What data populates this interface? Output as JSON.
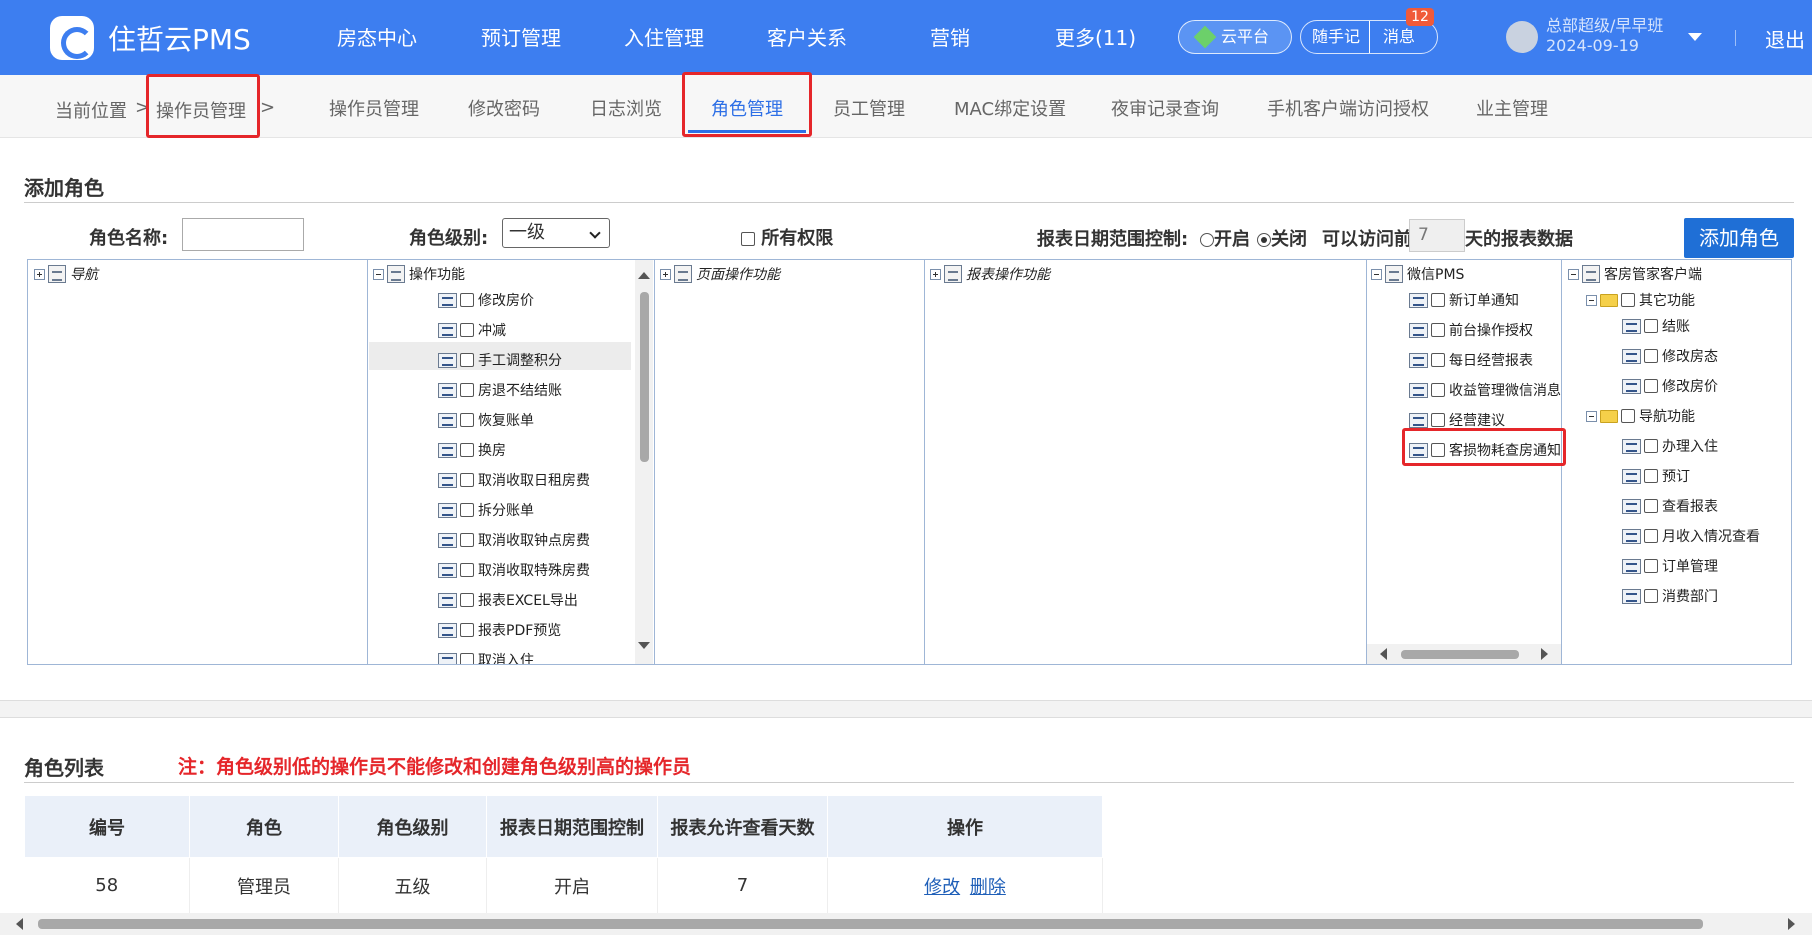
{
  "header": {
    "brand": "住哲云PMS",
    "nav": [
      "房态中心",
      "预订管理",
      "入住管理",
      "客户关系",
      "营销",
      "更多(11)"
    ],
    "cloud_platform": "云平台",
    "notes": "随手记",
    "messages": "消息",
    "message_count": "12",
    "user_name": "总部超级/早早班",
    "user_date": "2024-09-19",
    "logout": "退出"
  },
  "breadcrumb": {
    "label": "当前位置",
    "sep": ">",
    "current": "操作员管理",
    "sep2": ">"
  },
  "tabs": [
    "操作员管理",
    "修改密码",
    "日志浏览",
    "角色管理",
    "员工管理",
    "MAC绑定设置",
    "夜审记录查询",
    "手机客户端访问授权",
    "业主管理"
  ],
  "active_tab": "角色管理",
  "add_role": {
    "title": "添加角色",
    "name_label": "角色名称:",
    "name_value": "",
    "level_label": "角色级别:",
    "level_value": "一级",
    "all_permissions": "所有权限",
    "date_range_label": "报表日期范围控制:",
    "opt_on": "开启",
    "opt_off": "关闭",
    "access_prefix": "可以访问前",
    "days_value": "7",
    "access_suffix": "天的报表数据",
    "add_button": "添加角色"
  },
  "tree": {
    "nav_root": "导航",
    "op_root": "操作功能",
    "op_items": [
      "修改房价",
      "冲减",
      "手工调整积分",
      "房退不结结账",
      "恢复账单",
      "换房",
      "取消收取日租房费",
      "拆分账单",
      "取消收取钟点房费",
      "取消收取特殊房费",
      "报表EXCEL导出",
      "报表PDF预览",
      "取消入住"
    ],
    "page_root": "页面操作功能",
    "report_root": "报表操作功能",
    "wx_root": "微信PMS",
    "wx_items": [
      "新订单通知",
      "前台操作授权",
      "每日经营报表",
      "收益管理微信消息",
      "经营建议",
      "客损物耗查房通知"
    ],
    "hk_root": "客房管家客户端",
    "hk_group1": "其它功能",
    "hk_group1_items": [
      "结账",
      "修改房态",
      "修改房价"
    ],
    "hk_group2": "导航功能",
    "hk_group2_items": [
      "办理入住",
      "预订",
      "查看报表",
      "月收入情况查看",
      "订单管理",
      "消费部门"
    ]
  },
  "role_list": {
    "title": "角色列表",
    "warning": "注：角色级别低的操作员不能修改和创建角色级别高的操作员",
    "columns": [
      "编号",
      "角色",
      "角色级别",
      "报表日期范围控制",
      "报表允许查看天数",
      "操作"
    ],
    "rows": [
      {
        "id": "58",
        "role": "管理员",
        "level": "五级",
        "date_ctrl": "开启",
        "days": "7",
        "edit": "修改",
        "delete": "删除"
      }
    ]
  }
}
